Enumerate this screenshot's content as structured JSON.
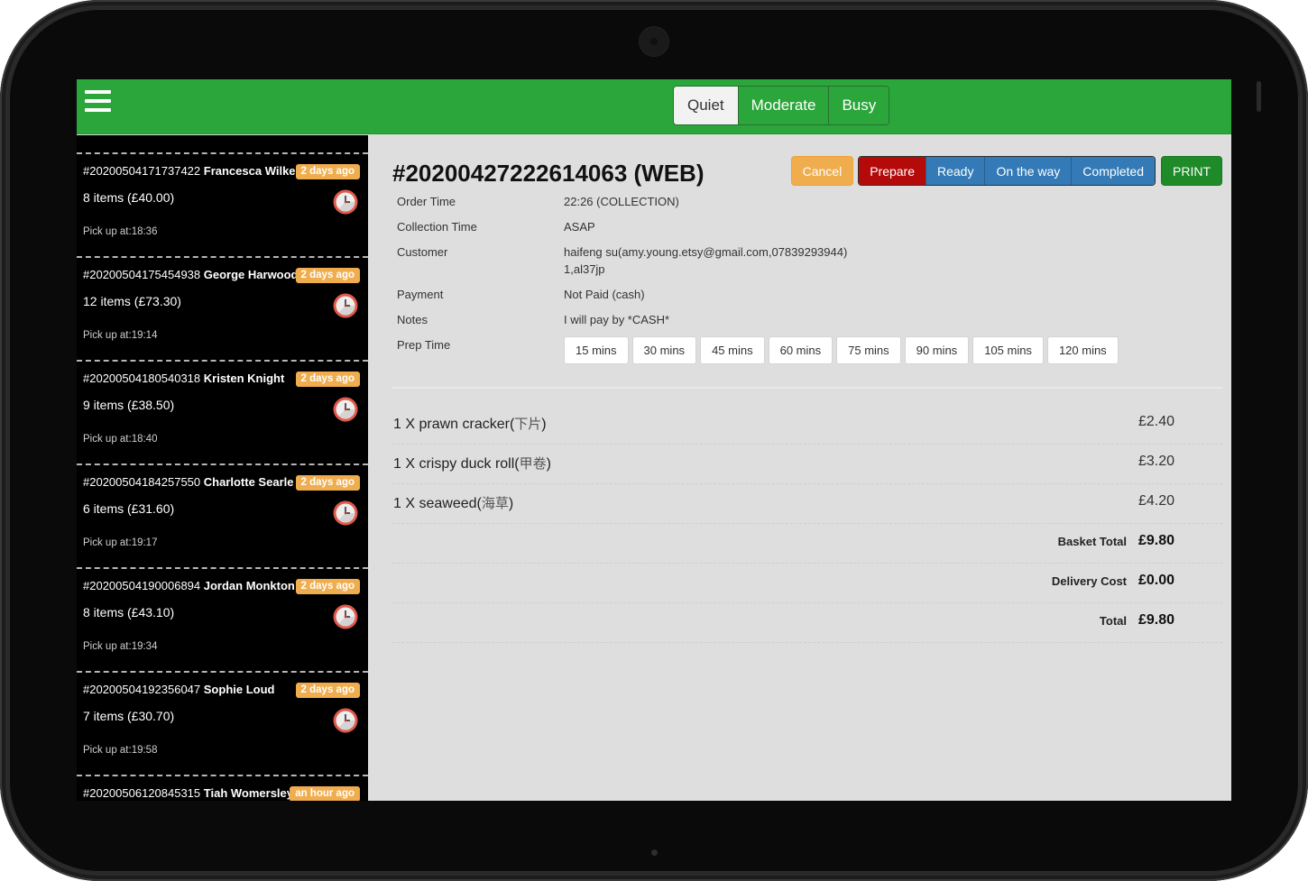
{
  "header": {
    "menu_icon": "hamburger-menu-icon",
    "busy_levels": [
      {
        "label": "Quiet",
        "active": true
      },
      {
        "label": "Moderate",
        "active": false
      },
      {
        "label": "Busy",
        "active": false
      }
    ]
  },
  "sidebar": {
    "orders": [
      {
        "number": "#20200504171737422",
        "name": "Francesca Wilkes",
        "age": "2 days ago",
        "items": "8 items (£40.00)",
        "pickup": "Pick up at:18:36",
        "icon": "clock-icon"
      },
      {
        "number": "#20200504175454938",
        "name": "George Harwood",
        "age": "2 days ago",
        "items": "12 items (£73.30)",
        "pickup": "Pick up at:19:14",
        "icon": "clock-icon"
      },
      {
        "number": "#20200504180540318",
        "name": "Kristen Knight",
        "age": "2 days ago",
        "items": "9 items (£38.50)",
        "pickup": "Pick up at:18:40",
        "icon": "clock-icon"
      },
      {
        "number": "#20200504184257550",
        "name": "Charlotte Searle",
        "age": "2 days ago",
        "items": "6 items (£31.60)",
        "pickup": "Pick up at:19:17",
        "icon": "clock-icon"
      },
      {
        "number": "#20200504190006894",
        "name": "Jordan Monkton",
        "age": "2 days ago",
        "items": "8 items (£43.10)",
        "pickup": "Pick up at:19:34",
        "icon": "clock-icon"
      },
      {
        "number": "#20200504192356047",
        "name": "Sophie Loud",
        "age": "2 days ago",
        "items": "7 items (£30.70)",
        "pickup": "Pick up at:19:58",
        "icon": "clock-icon"
      },
      {
        "number": "#20200506120845315",
        "name": "Tiah Womersley",
        "age": "an hour ago",
        "items": "",
        "pickup": "",
        "icon": "clock-icon"
      }
    ]
  },
  "order": {
    "title": "#20200427222614063 (WEB)",
    "actions": {
      "cancel": "Cancel",
      "prepare": "Prepare",
      "ready": "Ready",
      "on_the_way": "On the way",
      "completed": "Completed",
      "print": "PRINT"
    },
    "details": {
      "order_time_label": "Order Time",
      "order_time": "22:26 (COLLECTION)",
      "collection_time_label": "Collection Time",
      "collection_time": "ASAP",
      "customer_label": "Customer",
      "customer_line1": "haifeng su(amy.young.etsy@gmail.com,07839293944)",
      "customer_line2": "1,al37jp",
      "payment_label": "Payment",
      "payment": "Not Paid (cash)",
      "notes_label": "Notes",
      "notes": "I will pay by *CASH*",
      "prep_time_label": "Prep Time"
    },
    "prep_times": [
      "15 mins",
      "30 mins",
      "45 mins",
      "60 mins",
      "75 mins",
      "90 mins",
      "105 mins",
      "120 mins"
    ],
    "items": [
      {
        "qty": "1 X",
        "name": "prawn cracker(",
        "name_zh": "下片",
        "close": ")",
        "price": "£2.40"
      },
      {
        "qty": "1 X",
        "name": "crispy duck roll(",
        "name_zh": "甲卷",
        "close": ")",
        "price": "£3.20"
      },
      {
        "qty": "1 X",
        "name": "seaweed(",
        "name_zh": "海草",
        "close": ")",
        "price": "£4.20"
      }
    ],
    "totals": [
      {
        "label": "Basket Total",
        "value": "£9.80"
      },
      {
        "label": "Delivery Cost",
        "value": "£0.00"
      },
      {
        "label": "Total",
        "value": "£9.80"
      }
    ]
  },
  "colors": {
    "header_green": "#2ba63b",
    "badge_orange": "#f0ad4e",
    "prepare_red": "#b50a0a",
    "status_blue": "#337ab7",
    "print_green": "#1f8a28"
  }
}
